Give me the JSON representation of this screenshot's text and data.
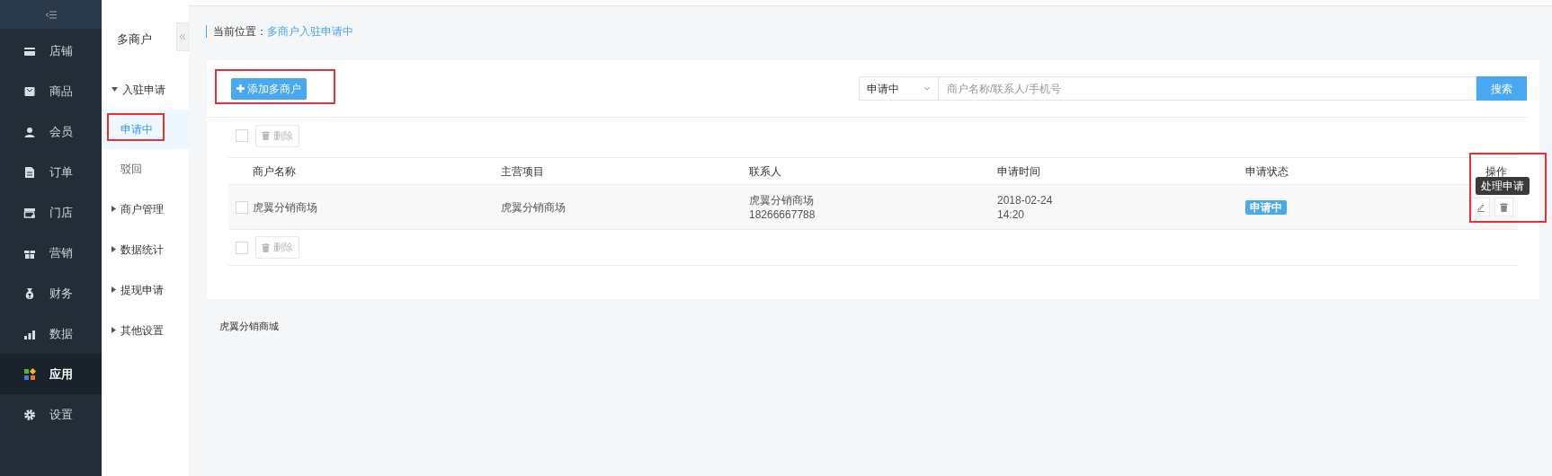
{
  "nav": [
    {
      "label": "店铺",
      "selected": false
    },
    {
      "label": "商品",
      "selected": false
    },
    {
      "label": "会员",
      "selected": false
    },
    {
      "label": "订单",
      "selected": false
    },
    {
      "label": "门店",
      "selected": false
    },
    {
      "label": "营销",
      "selected": false
    },
    {
      "label": "财务",
      "selected": false
    },
    {
      "label": "数据",
      "selected": false
    },
    {
      "label": "应用",
      "selected": true
    },
    {
      "label": "设置",
      "selected": false
    }
  ],
  "subnav": {
    "title": "多商户",
    "groups": [
      {
        "label": "入驻申请",
        "expanded": true,
        "children": [
          {
            "label": "申请中",
            "selected": true
          },
          {
            "label": "驳回",
            "selected": false
          }
        ]
      },
      {
        "label": "商户管理",
        "expanded": false
      },
      {
        "label": "数据统计",
        "expanded": false
      },
      {
        "label": "提现申请",
        "expanded": false
      },
      {
        "label": "其他设置",
        "expanded": false
      }
    ]
  },
  "breadcrumb": {
    "label": "当前位置：",
    "current": "多商户入驻申请中"
  },
  "add_button": "添加多商户",
  "filter": {
    "value": "申请中",
    "placeholder": "商户名称/联系人/手机号",
    "button": "搜索"
  },
  "toolbars": [
    {
      "checked": false,
      "delete_button": "删除"
    },
    {
      "checked": false,
      "delete_button": "删除"
    }
  ],
  "table": {
    "columns": [
      "商户名称",
      "主营项目",
      "联系人",
      "申请时间",
      "申请状态",
      "操作"
    ],
    "rows": [
      {
        "checked": false,
        "name": "虎翼分销商场",
        "business": "虎翼分销商场",
        "contact": [
          "虎翼分销商场",
          "18266667788"
        ],
        "time": [
          "2018-02-24",
          "14:20"
        ],
        "status": "申请中"
      }
    ]
  },
  "tooltip": "处理申请",
  "footer": "虎翼分销商城"
}
